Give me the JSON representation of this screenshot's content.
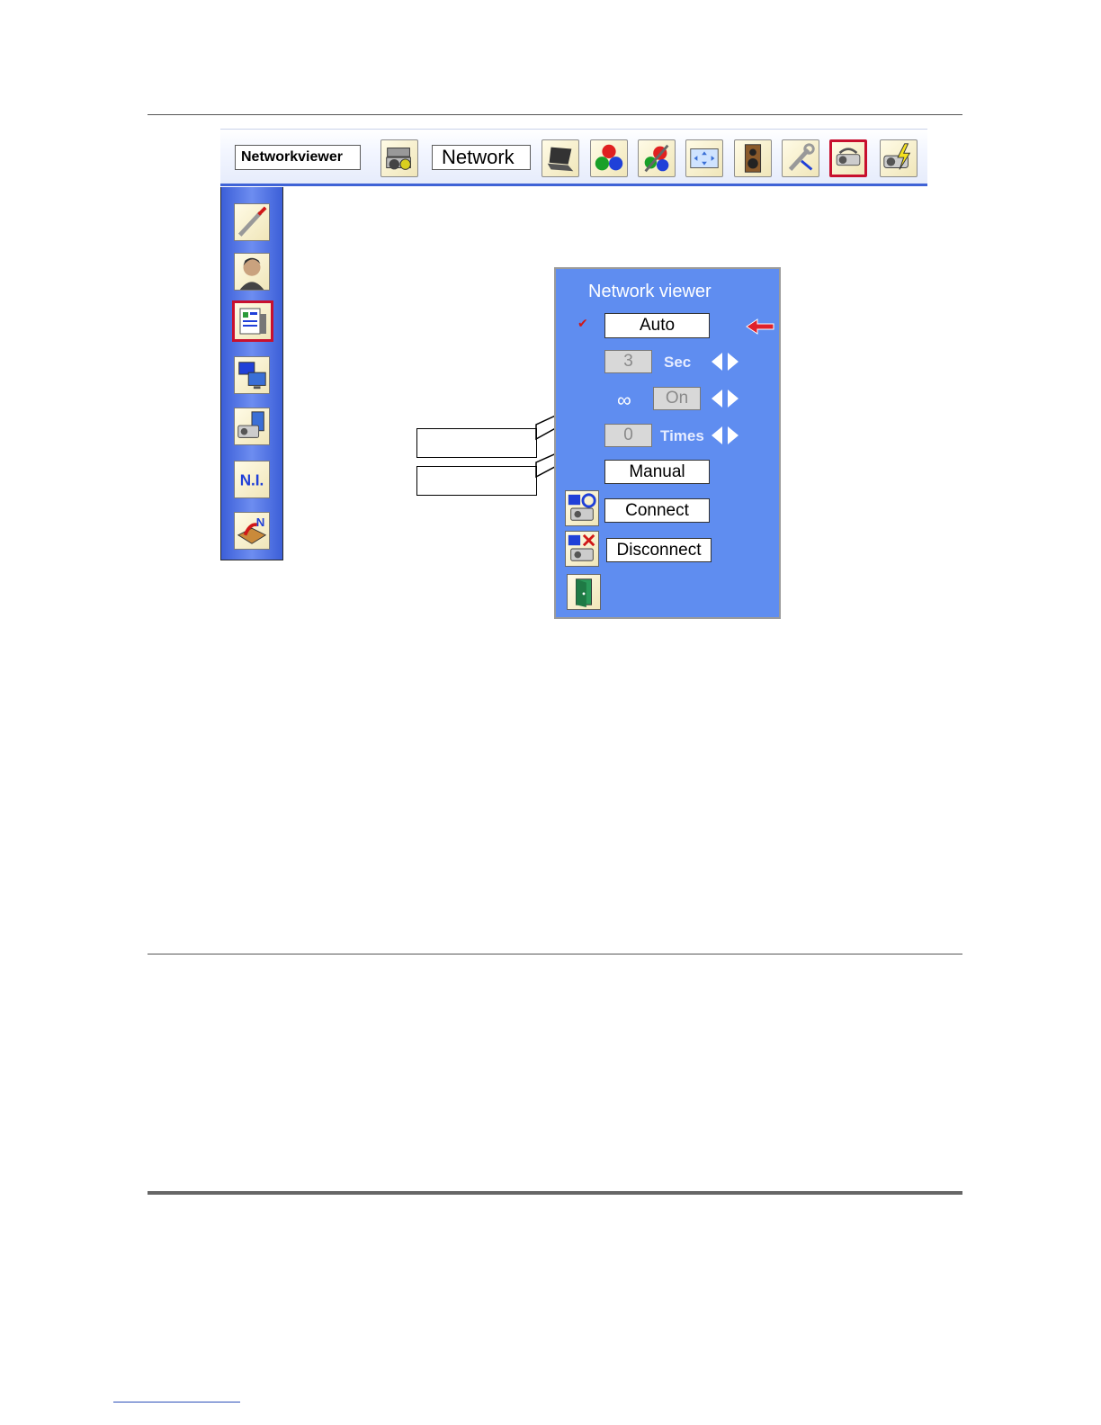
{
  "menubar": {
    "label_primary": "Networkviewer",
    "label_secondary": "Network",
    "icons": [
      "network-viewer-tool-icon",
      "laptop-icon",
      "rgb-balls-icon",
      "color-adjust-icon",
      "screen-icon",
      "speaker-icon",
      "wrench-icon",
      "network-projector-icon",
      "power-projector-icon"
    ]
  },
  "sidebar": {
    "icons": [
      "setting-tool-icon",
      "person-icon",
      "network-viewer-icon",
      "network-pc-icon",
      "projector-settings-icon",
      "ni-icon",
      "network-update-icon"
    ],
    "ni_text": "N.I."
  },
  "dialog": {
    "title": "Network viewer",
    "auto_label": "Auto",
    "interval_value": "3",
    "interval_unit": "Sec",
    "repeat_value": "On",
    "times_value": "0",
    "times_unit": "Times",
    "manual_label": "Manual",
    "connect_label": "Connect",
    "disconnect_label": "Disconnect",
    "infinity_symbol": "∞",
    "checkmark": "✔"
  },
  "colors": {
    "menu_accent": "#3f63d6",
    "dialog_bg": "#5f8df0",
    "selected_border": "#c8102e",
    "pointer_arrow": "#e0212b"
  }
}
